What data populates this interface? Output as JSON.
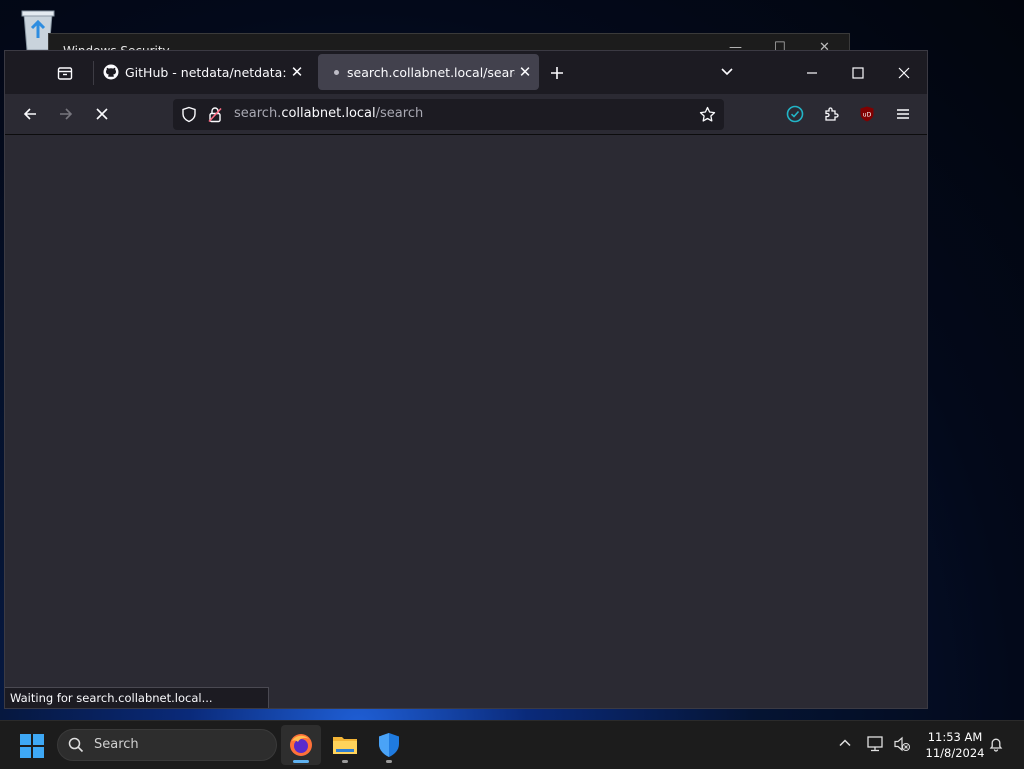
{
  "desktop": {
    "recycle_bin_icon": "recycle-bin-icon",
    "background_window": {
      "title": "Windows Security"
    }
  },
  "browser": {
    "tabs": [
      {
        "label": "GitHub - netdata/netdata: Arch",
        "favicon": "github-icon",
        "active": false
      },
      {
        "label": "search.collabnet.local/search",
        "favicon": "loading-dot",
        "active": true
      }
    ],
    "url": {
      "full": "search.collabnet.local/search",
      "host": "collabnet.local",
      "prefix": "search.",
      "path": "/search"
    },
    "status_text": "Waiting for search.collabnet.local...",
    "colors": {
      "chrome": "#1c1b22",
      "toolbar": "#2b2a33",
      "active_tab": "#42414d",
      "extension_check": "#22b5c7",
      "ublock": "#800000"
    }
  },
  "taskbar": {
    "search_label": "Search",
    "apps": [
      "firefox-icon",
      "file-explorer-icon",
      "windows-security-icon"
    ],
    "clock": {
      "time": "11:53 AM",
      "date": "11/8/2024"
    }
  }
}
